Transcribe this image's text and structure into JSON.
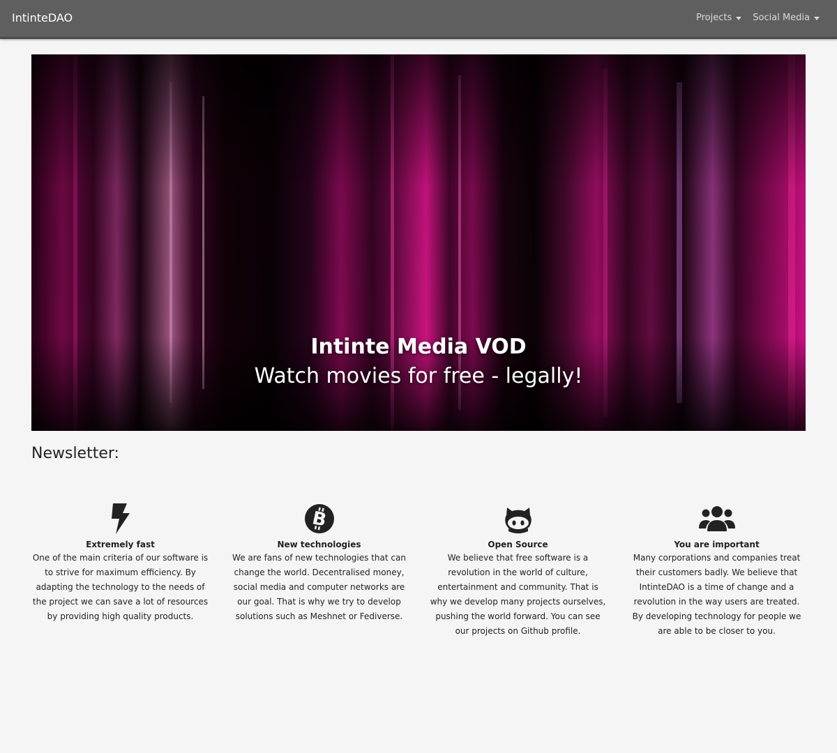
{
  "navbar": {
    "brand": "IntinteDAO",
    "menu": [
      {
        "label": "Projects"
      },
      {
        "label": "Social Media"
      }
    ]
  },
  "hero": {
    "title": "Intinte Media VOD",
    "subtitle": "Watch movies for free - legally!"
  },
  "newsletter": {
    "label": "Newsletter:"
  },
  "features": [
    {
      "icon": "lightning-bolt-icon",
      "title": "Extremely fast",
      "text": "One of the main criteria of our software is to strive for maximum efficiency. By adapting the technology to the needs of the project we can save a lot of resources by providing high quality products."
    },
    {
      "icon": "bitcoin-icon",
      "title": "New technologies",
      "text": "We are fans of new technologies that can change the world. Decentralised money, social media and computer networks are our goal. That is why we try to develop solutions such as Meshnet or Fediverse."
    },
    {
      "icon": "github-icon",
      "title": "Open Source",
      "text": "We believe that free software is a revolution in the world of culture, entertainment and community. That is why we develop many projects ourselves, pushing the world forward. You can see our projects on Github profile."
    },
    {
      "icon": "users-icon",
      "title": "You are important",
      "text": "Many corporations and companies treat their customers badly. We believe that IntinteDAO is a time of change and a revolution in the way users are treated. By developing technology for people we are able to be closer to you."
    }
  ],
  "colors": {
    "navbar_bg": "#5f5f5f",
    "page_bg": "#f5f5f5",
    "hero_accent": "#d1127f"
  }
}
